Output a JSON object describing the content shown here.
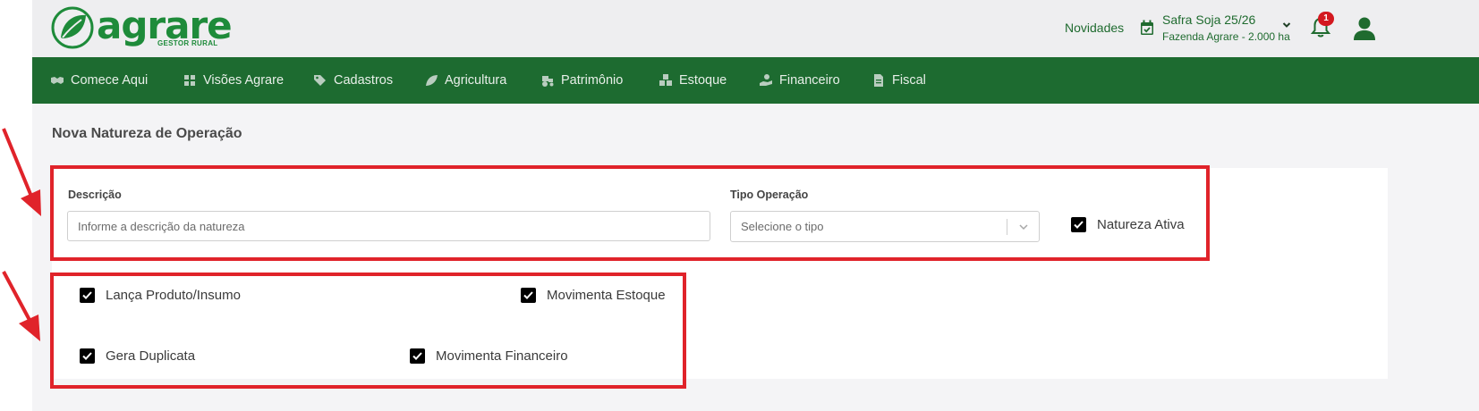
{
  "header": {
    "logo": {
      "text": "agrare",
      "subtitle": "GESTOR RURAL"
    },
    "novidades_label": "Novidades",
    "safra": {
      "title": "Safra Soja 25/26",
      "farm": "Fazenda Agrare - 2.000 ha"
    },
    "notification_count": "1",
    "brand_color": "#1e8b3a"
  },
  "nav": {
    "color": "#1d6b30",
    "items": [
      {
        "label": "Comece Aqui",
        "icon": "handshake-icon"
      },
      {
        "label": "Visões Agrare",
        "icon": "grid-icon"
      },
      {
        "label": "Cadastros",
        "icon": "tags-icon"
      },
      {
        "label": "Agricultura",
        "icon": "leaf-icon"
      },
      {
        "label": "Patrimônio",
        "icon": "tractor-icon"
      },
      {
        "label": "Estoque",
        "icon": "boxes-icon"
      },
      {
        "label": "Financeiro",
        "icon": "hand-coin-icon"
      },
      {
        "label": "Fiscal",
        "icon": "file-icon"
      }
    ]
  },
  "form": {
    "page_title": "Nova Natureza de Operação",
    "descricao": {
      "label": "Descrição",
      "placeholder": "Informe a descrição da natureza",
      "value": ""
    },
    "tipo_operacao": {
      "label": "Tipo Operação",
      "placeholder": "Selecione o tipo"
    },
    "natureza_ativa": {
      "label": "Natureza Ativa",
      "checked": true
    },
    "options": {
      "lanca_produto": {
        "label": "Lança Produto/Insumo",
        "checked": true
      },
      "movimenta_estoque": {
        "label": "Movimenta Estoque",
        "checked": true
      },
      "gera_duplicata": {
        "label": "Gera Duplicata",
        "checked": true
      },
      "movimenta_financeiro": {
        "label": "Movimenta Financeiro",
        "checked": true
      }
    }
  },
  "annotation_color": "#e0232a"
}
